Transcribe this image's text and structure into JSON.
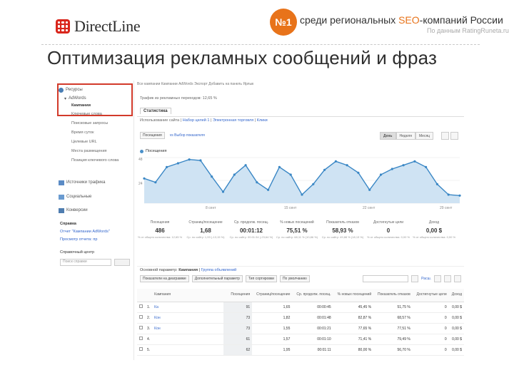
{
  "header": {
    "logo_text": "DirectLine",
    "badge_number": "№1",
    "badge_text_pre": "среди региональных ",
    "badge_text_hl": "SEO",
    "badge_text_post": "-компаний России",
    "badge_sub": "По данным RatingRuneta.ru",
    "title": "Оптимизация рекламных сообщений и фраз"
  },
  "sidebar": {
    "reports": "Ресурсы",
    "adwords": "AdWords",
    "items": [
      "Кампании",
      "Ключевые слова",
      "Поисковые запросы",
      "Время суток",
      "Целевые URL",
      "Места размещения",
      "Позиция ключевого слова"
    ],
    "sources": "Источники трафика",
    "social": "Социальные",
    "conversions": "Конверсии",
    "help_title": "Справка",
    "help_links": [
      "Отчет \"Кампании AdWords\"",
      "Просмотр отчета: пр"
    ],
    "search_label": "Справочный центр",
    "search_placeholder": "Поиск справки"
  },
  "main": {
    "topline": "Все кампании    Кампании AdWords    Экспорт    Добавить на панель    Ярлык",
    "segment": "Трафик из рекламных переходов: 12,65 %",
    "tab": "Статистика",
    "subnav_a": "Использование сайта",
    "subnav_b": "Набор целей 1",
    "subnav_c": "Электронная торговля",
    "subnav_d": "Клики",
    "dd1": "Посещения",
    "dd2": "vs Выбор показателя",
    "seg_day": "День",
    "seg_week": "Неделя",
    "seg_month": "Месяц",
    "legend": "Посещения",
    "y_top": "48",
    "y_mid": "24",
    "x_ticks": [
      "8 сент",
      "15 сент",
      "22 сент",
      "29 сент"
    ]
  },
  "chart_data": {
    "type": "area",
    "series": [
      {
        "name": "Посещения",
        "values": [
          26,
          22,
          38,
          42,
          46,
          45,
          28,
          12,
          30,
          40,
          22,
          14,
          38,
          30,
          9,
          20,
          35,
          44,
          40,
          32,
          14,
          30,
          36,
          40,
          44,
          38,
          20,
          9,
          8
        ]
      }
    ],
    "ylim": [
      0,
      48
    ]
  },
  "metrics": [
    {
      "label": "Посещения",
      "value": "486",
      "desc": "% от общего количества: 12,65 %"
    },
    {
      "label": "Страниц/посещение",
      "value": "1,68",
      "desc": "Ср. по сайту: 1,93 (-13,15 %)"
    },
    {
      "label": "Ср. продолж. посещ.",
      "value": "00:01:12",
      "desc": "Ср. по сайту: 00:01:34 (-23,64 %)"
    },
    {
      "label": "% новых посещений",
      "value": "75,51 %",
      "desc": "Ср. по сайту: 68,11 % (10,86 %)"
    },
    {
      "label": "Показатель отказов",
      "value": "58,93 %",
      "desc": "Ср. по сайту: 49,88 % (18,13 %)"
    },
    {
      "label": "Достигнутые цели",
      "value": "0",
      "desc": "% от общего количества: 0,00 %"
    },
    {
      "label": "Доход",
      "value": "0,00 $",
      "desc": "% от общего количества: 0,00 %"
    }
  ],
  "dimension": {
    "label": "Основной параметр:",
    "active": "Кампания",
    "other": "Группа объявлений"
  },
  "table_controls": {
    "c1": "Показатели на диаграмме",
    "c2": "Дополнительный параметр",
    "c3": "Тип сортировки",
    "c4": "По умолчанию",
    "adv": "Расш."
  },
  "table": {
    "headers": [
      "Кампания",
      "Посещения",
      "Страниц/посещение",
      "Ср. продолж. посещ.",
      "% новых посещений",
      "Показатель отказов",
      "Достигнутые цели",
      "Доход"
    ],
    "rows": [
      {
        "n": "1.",
        "name": "Ка",
        "visits": "91",
        "ppv": "1,65",
        "dur": "00:00:45",
        "new": "45,45 %",
        "bounce": "51,75 %",
        "goals": "0",
        "rev": "0,00 $"
      },
      {
        "n": "2.",
        "name": "Кон",
        "visits": "73",
        "ppv": "1,82",
        "dur": "00:01:48",
        "new": "82,87 %",
        "bounce": "68,57 %",
        "goals": "0",
        "rev": "0,00 $"
      },
      {
        "n": "3.",
        "name": "Кон",
        "visits": "73",
        "ppv": "1,55",
        "dur": "00:01:21",
        "new": "77,65 %",
        "bounce": "77,51 %",
        "goals": "0",
        "rev": "0,00 $"
      },
      {
        "n": "4.",
        "name": "",
        "visits": "61",
        "ppv": "1,57",
        "dur": "00:01:10",
        "new": "71,41 %",
        "bounce": "79,49 %",
        "goals": "0",
        "rev": "0,00 $"
      },
      {
        "n": "5.",
        "name": "",
        "visits": "62",
        "ppv": "1,95",
        "dur": "00:01:11",
        "new": "80,00 %",
        "bounce": "56,70 %",
        "goals": "0",
        "rev": "0,00 $"
      }
    ]
  },
  "colors": {
    "accent": "#e8731a",
    "brand_red": "#d9261c",
    "chart_line": "#3a87c5",
    "chart_fill": "#cfe3f3",
    "highlight_box": "#d23a2a"
  }
}
